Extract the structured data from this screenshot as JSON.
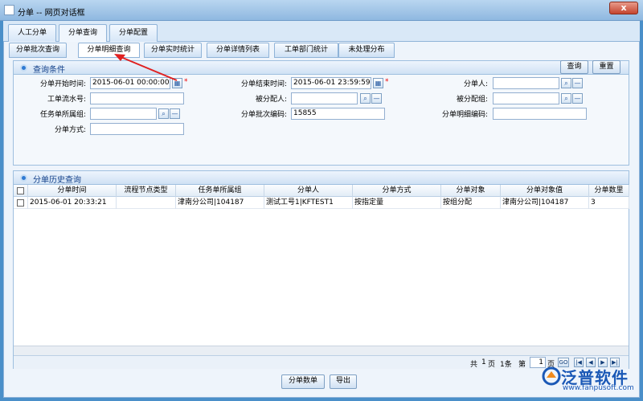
{
  "window": {
    "title": "分单 -- 网页对话框",
    "close_label": "x"
  },
  "tabs_main": [
    {
      "label": "人工分单"
    },
    {
      "label": "分单查询"
    },
    {
      "label": "分单配置"
    }
  ],
  "tabs_sub": [
    {
      "label": "分单批次查询"
    },
    {
      "label": "分单明细查询"
    },
    {
      "label": "分单实时统计"
    },
    {
      "label": "分单详情列表"
    },
    {
      "label": "工单部门统计"
    },
    {
      "label": "未处理分布"
    }
  ],
  "query": {
    "title": "查询条件",
    "query_button": "查询",
    "reset_button": "重置",
    "start_time_label": "分单开始时间:",
    "start_time_value": "2015-06-01 00:00:00",
    "end_time_label": "分单结束时间:",
    "end_time_value": "2015-06-01 23:59:59",
    "assigner_label": "分单人:",
    "assigner_value": "",
    "flow_no_label": "工单流水号:",
    "flow_no_value": "",
    "assignee_label": "被分配人:",
    "assignee_value": "",
    "assignee_group_label": "被分配组:",
    "assignee_group_value": "",
    "task_group_label": "任务单所属组:",
    "task_group_value": "",
    "batch_code_label": "分单批次编码:",
    "batch_code_value": "15855",
    "detail_code_label": "分单明细编码:",
    "detail_code_value": "",
    "method_label": "分单方式:",
    "method_value": "",
    "required_mark": "*"
  },
  "history": {
    "title": "分单历史查询",
    "columns": [
      "分单时间",
      "流程节点类型",
      "任务单所属组",
      "分单人",
      "分单方式",
      "分单对象",
      "分单对象值",
      "分单数里"
    ],
    "rows": [
      [
        "2015-06-01 20:33:21",
        "",
        "津南分公司|104187",
        "测试工号1|KFTEST1",
        "按指定量",
        "按组分配",
        "津南分公司|104187",
        "3"
      ]
    ]
  },
  "pager": {
    "total_label": "共",
    "pages": "1",
    "page_unit": "页",
    "records": "1条",
    "current_prefix": "第",
    "current_page": "1",
    "current_suffix": "页",
    "go_label": "GO"
  },
  "footer": {
    "count_button": "分单数单",
    "export_button": "导出"
  },
  "brand": {
    "name": "泛普软件",
    "url": "www.fanpusoft.com"
  },
  "colors": {
    "accent": "#15428b",
    "arrow": "#e02020",
    "required": "#e00000"
  },
  "icons": {
    "calendar": "calendar-icon",
    "search": "search-icon",
    "clear": "minus-icon"
  }
}
